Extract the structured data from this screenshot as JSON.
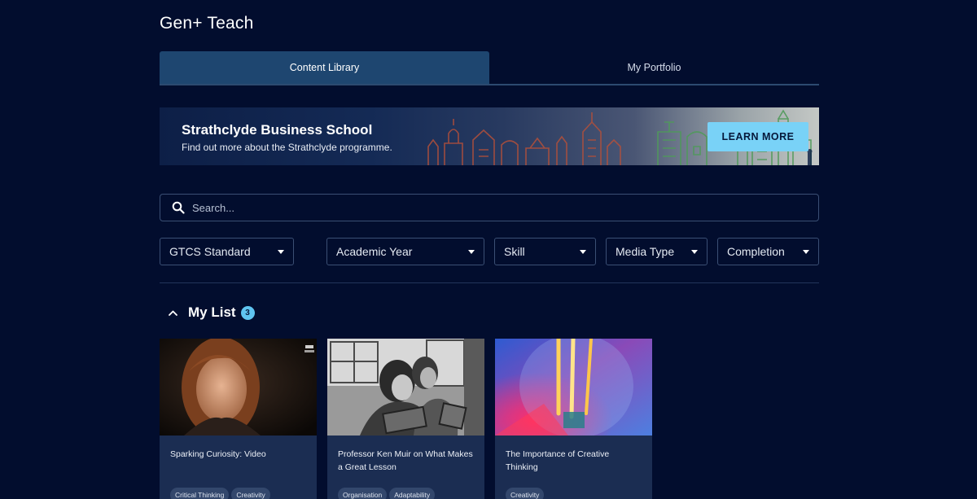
{
  "app": {
    "title": "Gen+ Teach"
  },
  "tabs": [
    {
      "label": "Content Library",
      "active": true
    },
    {
      "label": "My Portfolio",
      "active": false
    }
  ],
  "banner": {
    "title": "Strathclyde Business School",
    "subtitle": "Find out more about the Strathclyde programme.",
    "button_label": "LEARN MORE"
  },
  "search": {
    "placeholder": "Search...",
    "value": ""
  },
  "filters": [
    {
      "label": "GTCS Standard"
    },
    {
      "label": "Academic Year"
    },
    {
      "label": "Skill"
    },
    {
      "label": "Media Type"
    },
    {
      "label": "Completion"
    }
  ],
  "my_list": {
    "title": "My List",
    "count": "3",
    "cards": [
      {
        "title": "Sparking Curiosity: Video",
        "tags": [
          "Critical Thinking",
          "Creativity"
        ]
      },
      {
        "title": "Professor Ken Muir on What Makes a Great Lesson",
        "tags": [
          "Organisation",
          "Adaptability"
        ]
      },
      {
        "title": "The Importance of Creative Thinking",
        "tags": [
          "Creativity"
        ]
      }
    ]
  },
  "colors": {
    "background": "#020d2e",
    "active_tab": "#1e4670",
    "accent": "#79d2f7",
    "card": "#1b2d52"
  },
  "icons": {
    "search": "search-icon",
    "caret": "chevron-down-icon",
    "collapse": "chevron-up-icon"
  }
}
